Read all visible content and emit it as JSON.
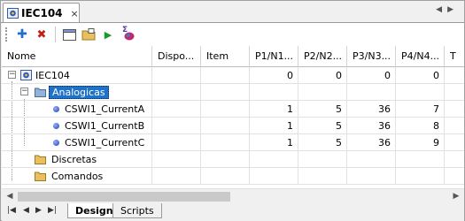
{
  "tab": {
    "title": "IEC104",
    "close_glyph": "×",
    "nav_left": "◀",
    "nav_right": "▶"
  },
  "toolbar": {
    "buttons": [
      {
        "name": "add-button",
        "icon": "plus-icon",
        "glyph": "✚",
        "color": "#1f6fd0"
      },
      {
        "name": "delete-button",
        "icon": "x-icon",
        "glyph": "✖",
        "color": "#c0201a"
      },
      {
        "name": "properties-button",
        "icon": "window-icon",
        "glyph": "▭",
        "color": "#444"
      },
      {
        "name": "import-button",
        "icon": "folder-icon",
        "glyph": "▤",
        "color": "#c8a020"
      },
      {
        "name": "run-button",
        "icon": "play-icon",
        "glyph": "▶",
        "color": "#1a9a2a"
      },
      {
        "name": "script-button",
        "icon": "sigma-icon",
        "glyph": "Σ",
        "color": "#5a3aa0"
      }
    ]
  },
  "grid": {
    "columns": [
      "Nome",
      "Dispo...",
      "Item",
      "P1/N1...",
      "P2/N2...",
      "P3/N3...",
      "P4/N4...",
      "T"
    ],
    "rows": [
      {
        "name": "IEC104",
        "level": 0,
        "type": "root",
        "expander": "−",
        "p1": "0",
        "p2": "0",
        "p3": "0",
        "p4": "0"
      },
      {
        "name": "Analogicas",
        "level": 1,
        "type": "folder",
        "expander": "−",
        "selected": true,
        "p1": "",
        "p2": "",
        "p3": "",
        "p4": ""
      },
      {
        "name": "CSWI1_CurrentA",
        "level": 2,
        "type": "point",
        "p1": "1",
        "p2": "5",
        "p3": "36",
        "p4": "7"
      },
      {
        "name": "CSWI1_CurrentB",
        "level": 2,
        "type": "point",
        "p1": "1",
        "p2": "5",
        "p3": "36",
        "p4": "8"
      },
      {
        "name": "CSWI1_CurrentC",
        "level": 2,
        "type": "point",
        "p1": "1",
        "p2": "5",
        "p3": "36",
        "p4": "9"
      },
      {
        "name": "Discretas",
        "level": 1,
        "type": "folder",
        "p1": "",
        "p2": "",
        "p3": "",
        "p4": ""
      },
      {
        "name": "Comandos",
        "level": 1,
        "type": "folder",
        "p1": "",
        "p2": "",
        "p3": "",
        "p4": ""
      }
    ]
  },
  "scrollbar": {
    "left_arrow": "◀",
    "right_arrow": "▶"
  },
  "bottom_tabs": [
    {
      "label": "Design",
      "active": true
    },
    {
      "label": "Scripts",
      "active": false
    }
  ],
  "bottom_nav": {
    "first": "|◀",
    "prev": "◀",
    "next": "▶",
    "last": "▶|"
  },
  "colors": {
    "selection": "#1e73c8",
    "folder": "#e8c060",
    "root_icon": "#2a5ab8"
  }
}
